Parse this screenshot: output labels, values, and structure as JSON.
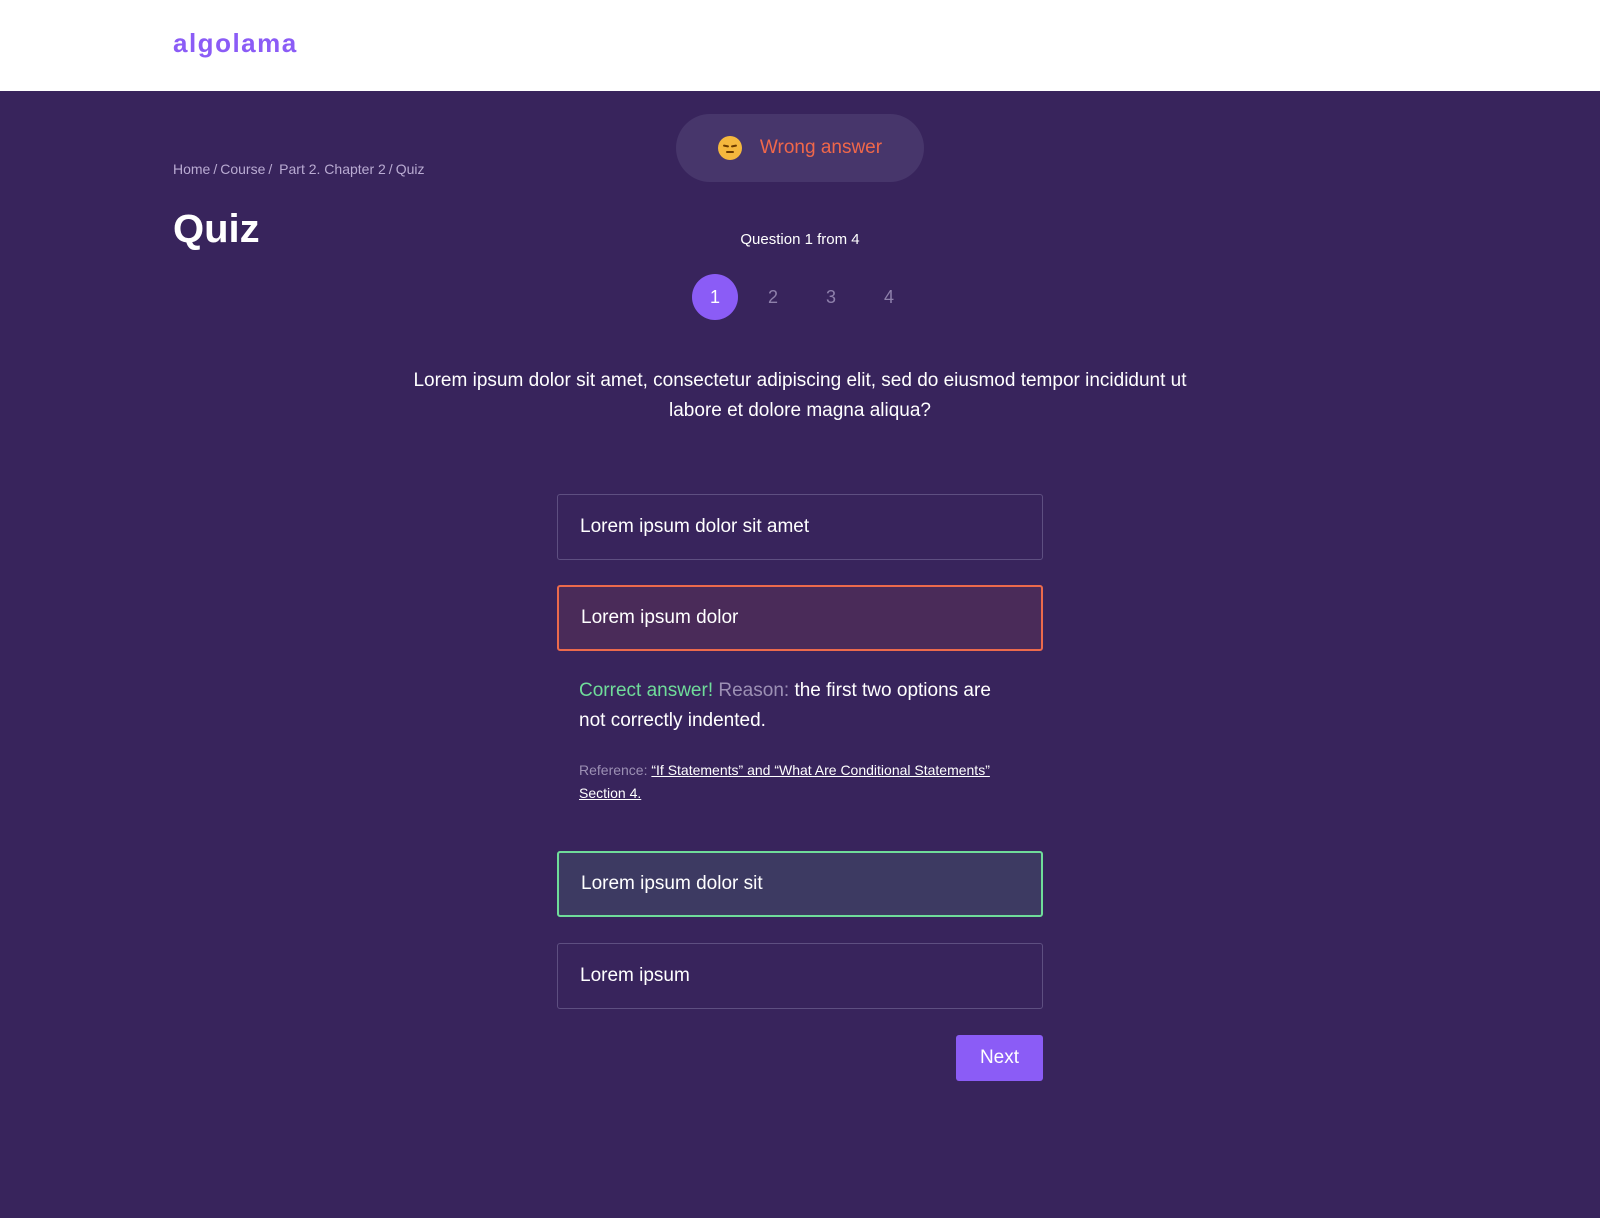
{
  "app": {
    "logo": "algolama"
  },
  "breadcrumb": {
    "items": [
      "Home",
      "Course",
      "Part 2. Chapter 2",
      "Quiz"
    ]
  },
  "page": {
    "title": "Quiz"
  },
  "toast": {
    "icon": "pensive-face-emoji",
    "text": "Wrong answer",
    "color": "#f0674a"
  },
  "quiz": {
    "counter": "Question 1 from 4",
    "pages": [
      "1",
      "2",
      "3",
      "4"
    ],
    "current_page": "1",
    "question": "Lorem ipsum dolor sit amet, consectetur adipiscing elit, sed do eiusmod tempor incididunt ut labore et dolore magna aliqua?",
    "options": [
      {
        "label": "Lorem ipsum dolor sit amet",
        "state": "default"
      },
      {
        "label": "Lorem ipsum dolor",
        "state": "wrong"
      },
      {
        "label": "Lorem ipsum dolor sit",
        "state": "correct"
      },
      {
        "label": "Lorem ipsum",
        "state": "default"
      }
    ],
    "feedback": {
      "correct_label": "Correct answer!",
      "reason_label": "Reason:",
      "reason_text": "the first two options are not correctly indented.",
      "reference_label": "Reference:",
      "reference_link": "“If Statements” and “What Are Conditional Statements” Section 4."
    },
    "next_label": "Next"
  },
  "colors": {
    "background": "#38245c",
    "accent": "#8b5cf6",
    "wrong": "#ec6a4c",
    "correct": "#6fdc9a"
  }
}
